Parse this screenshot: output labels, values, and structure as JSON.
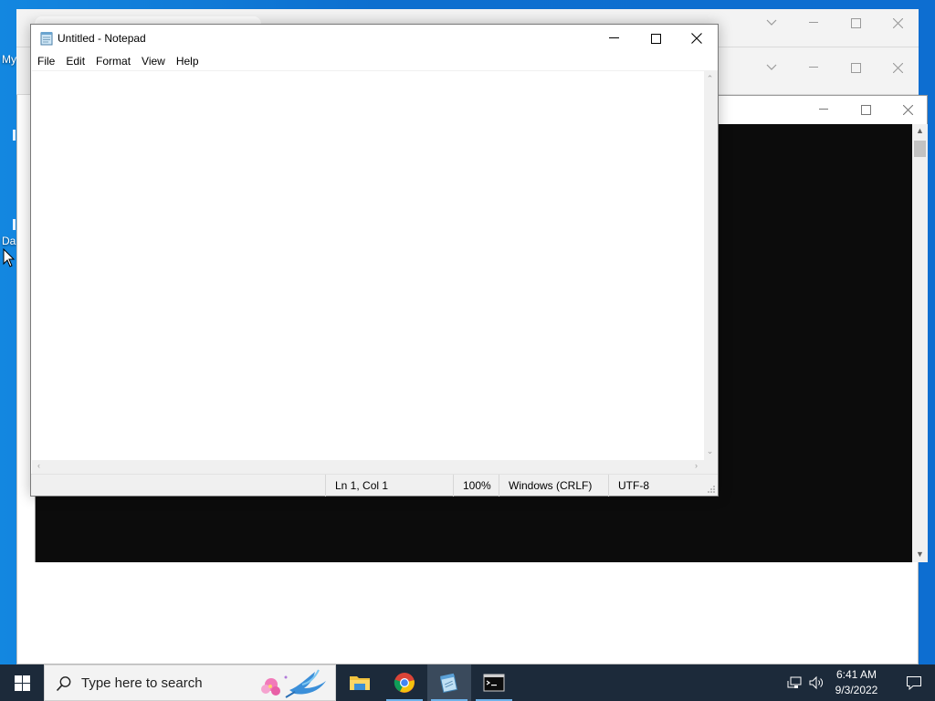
{
  "desktop": {
    "icon_labels": [
      "My",
      "Da"
    ]
  },
  "notepad": {
    "title": "Untitled - Notepad",
    "menu": [
      "File",
      "Edit",
      "Format",
      "View",
      "Help"
    ],
    "content": "",
    "status": {
      "position": "Ln 1, Col 1",
      "zoom": "100%",
      "line_ending": "Windows (CRLF)",
      "encoding": "UTF-8"
    }
  },
  "taskbar": {
    "search_placeholder": "Type here to search",
    "apps": [
      "file-explorer",
      "chrome",
      "notepad",
      "command-prompt"
    ],
    "clock": {
      "time": "6:41 AM",
      "date": "9/3/2022"
    }
  },
  "colors": {
    "desktop_blue": "#0d6fcf",
    "taskbar": "#1c2a3a",
    "terminal_bg": "#0c0c0c",
    "accent": "#6fb3ea"
  }
}
